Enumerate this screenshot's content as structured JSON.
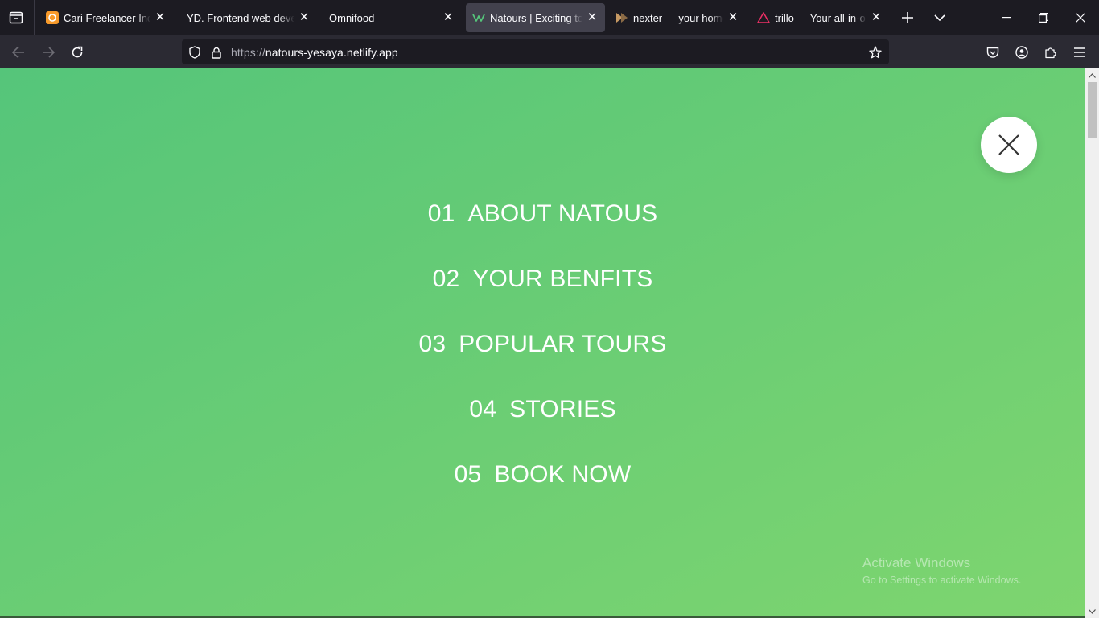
{
  "browser": {
    "tabs": [
      {
        "label": "Cari Freelancer Indonesia",
        "active": false,
        "icon": "freelancer-icon"
      },
      {
        "label": "YD. Frontend web developer",
        "active": false,
        "icon": "none"
      },
      {
        "label": "Omnifood",
        "active": false,
        "icon": "none"
      },
      {
        "label": "Natours | Exciting tours",
        "active": true,
        "icon": "natours-icon"
      },
      {
        "label": "nexter — your home, your",
        "active": false,
        "icon": "nexter-icon"
      },
      {
        "label": "trillo — Your all-in-one",
        "active": false,
        "icon": "trillo-icon"
      }
    ],
    "url": {
      "scheme": "https://",
      "host": "natours-yesaya.netlify.app"
    }
  },
  "page": {
    "menu": [
      {
        "number": "01",
        "label": "About Natous"
      },
      {
        "number": "02",
        "label": "Your benfits"
      },
      {
        "number": "03",
        "label": "Popular tours"
      },
      {
        "number": "04",
        "label": "Stories"
      },
      {
        "number": "05",
        "label": "Book now"
      }
    ]
  },
  "watermark": {
    "title": "Activate Windows",
    "subtitle": "Go to Settings to activate Windows."
  },
  "colors": {
    "accent_light": "#7ed56f",
    "accent_dark": "#55c57a",
    "tab_active": "#42414d",
    "toolbar": "#2b2a33"
  }
}
